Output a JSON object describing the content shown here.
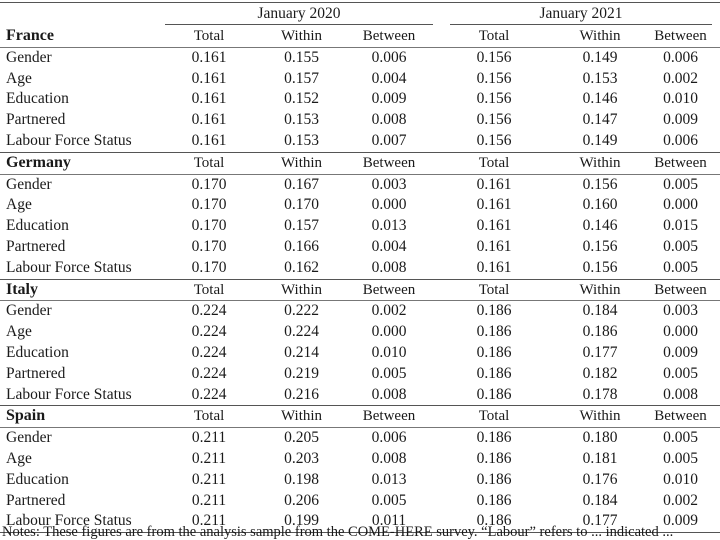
{
  "periods": [
    {
      "label": "January 2020"
    },
    {
      "label": "January 2021"
    }
  ],
  "column_headers": [
    "Total",
    "Within",
    "Between",
    "Total",
    "Within",
    "Between"
  ],
  "sections": [
    {
      "country": "France",
      "rows": [
        {
          "label": "Gender",
          "values": [
            "0.161",
            "0.155",
            "0.006",
            "0.156",
            "0.149",
            "0.006"
          ]
        },
        {
          "label": "Age",
          "values": [
            "0.161",
            "0.157",
            "0.004",
            "0.156",
            "0.153",
            "0.002"
          ]
        },
        {
          "label": "Education",
          "values": [
            "0.161",
            "0.152",
            "0.009",
            "0.156",
            "0.146",
            "0.010"
          ]
        },
        {
          "label": "Partnered",
          "values": [
            "0.161",
            "0.153",
            "0.008",
            "0.156",
            "0.147",
            "0.009"
          ]
        },
        {
          "label": "Labour Force Status",
          "values": [
            "0.161",
            "0.153",
            "0.007",
            "0.156",
            "0.149",
            "0.006"
          ]
        }
      ]
    },
    {
      "country": "Germany",
      "rows": [
        {
          "label": "Gender",
          "values": [
            "0.170",
            "0.167",
            "0.003",
            "0.161",
            "0.156",
            "0.005"
          ]
        },
        {
          "label": "Age",
          "values": [
            "0.170",
            "0.170",
            "0.000",
            "0.161",
            "0.160",
            "0.000"
          ]
        },
        {
          "label": "Education",
          "values": [
            "0.170",
            "0.157",
            "0.013",
            "0.161",
            "0.146",
            "0.015"
          ]
        },
        {
          "label": "Partnered",
          "values": [
            "0.170",
            "0.166",
            "0.004",
            "0.161",
            "0.156",
            "0.005"
          ]
        },
        {
          "label": "Labour Force Status",
          "values": [
            "0.170",
            "0.162",
            "0.008",
            "0.161",
            "0.156",
            "0.005"
          ]
        }
      ]
    },
    {
      "country": "Italy",
      "rows": [
        {
          "label": "Gender",
          "values": [
            "0.224",
            "0.222",
            "0.002",
            "0.186",
            "0.184",
            "0.003"
          ]
        },
        {
          "label": "Age",
          "values": [
            "0.224",
            "0.224",
            "0.000",
            "0.186",
            "0.186",
            "0.000"
          ]
        },
        {
          "label": "Education",
          "values": [
            "0.224",
            "0.214",
            "0.010",
            "0.186",
            "0.177",
            "0.009"
          ]
        },
        {
          "label": "Partnered",
          "values": [
            "0.224",
            "0.219",
            "0.005",
            "0.186",
            "0.182",
            "0.005"
          ]
        },
        {
          "label": "Labour Force Status",
          "values": [
            "0.224",
            "0.216",
            "0.008",
            "0.186",
            "0.178",
            "0.008"
          ]
        }
      ]
    },
    {
      "country": "Spain",
      "rows": [
        {
          "label": "Gender",
          "values": [
            "0.211",
            "0.205",
            "0.006",
            "0.186",
            "0.180",
            "0.005"
          ]
        },
        {
          "label": "Age",
          "values": [
            "0.211",
            "0.203",
            "0.008",
            "0.186",
            "0.181",
            "0.005"
          ]
        },
        {
          "label": "Education",
          "values": [
            "0.211",
            "0.198",
            "0.013",
            "0.186",
            "0.176",
            "0.010"
          ]
        },
        {
          "label": "Partnered",
          "values": [
            "0.211",
            "0.206",
            "0.005",
            "0.186",
            "0.184",
            "0.002"
          ]
        },
        {
          "label": "Labour Force Status",
          "values": [
            "0.211",
            "0.199",
            "0.011",
            "0.186",
            "0.177",
            "0.009"
          ]
        }
      ]
    }
  ],
  "note": "Notes: These figures are from the analysis sample from the COME-HERE survey. “Labour” refers to ... indicated ..."
}
